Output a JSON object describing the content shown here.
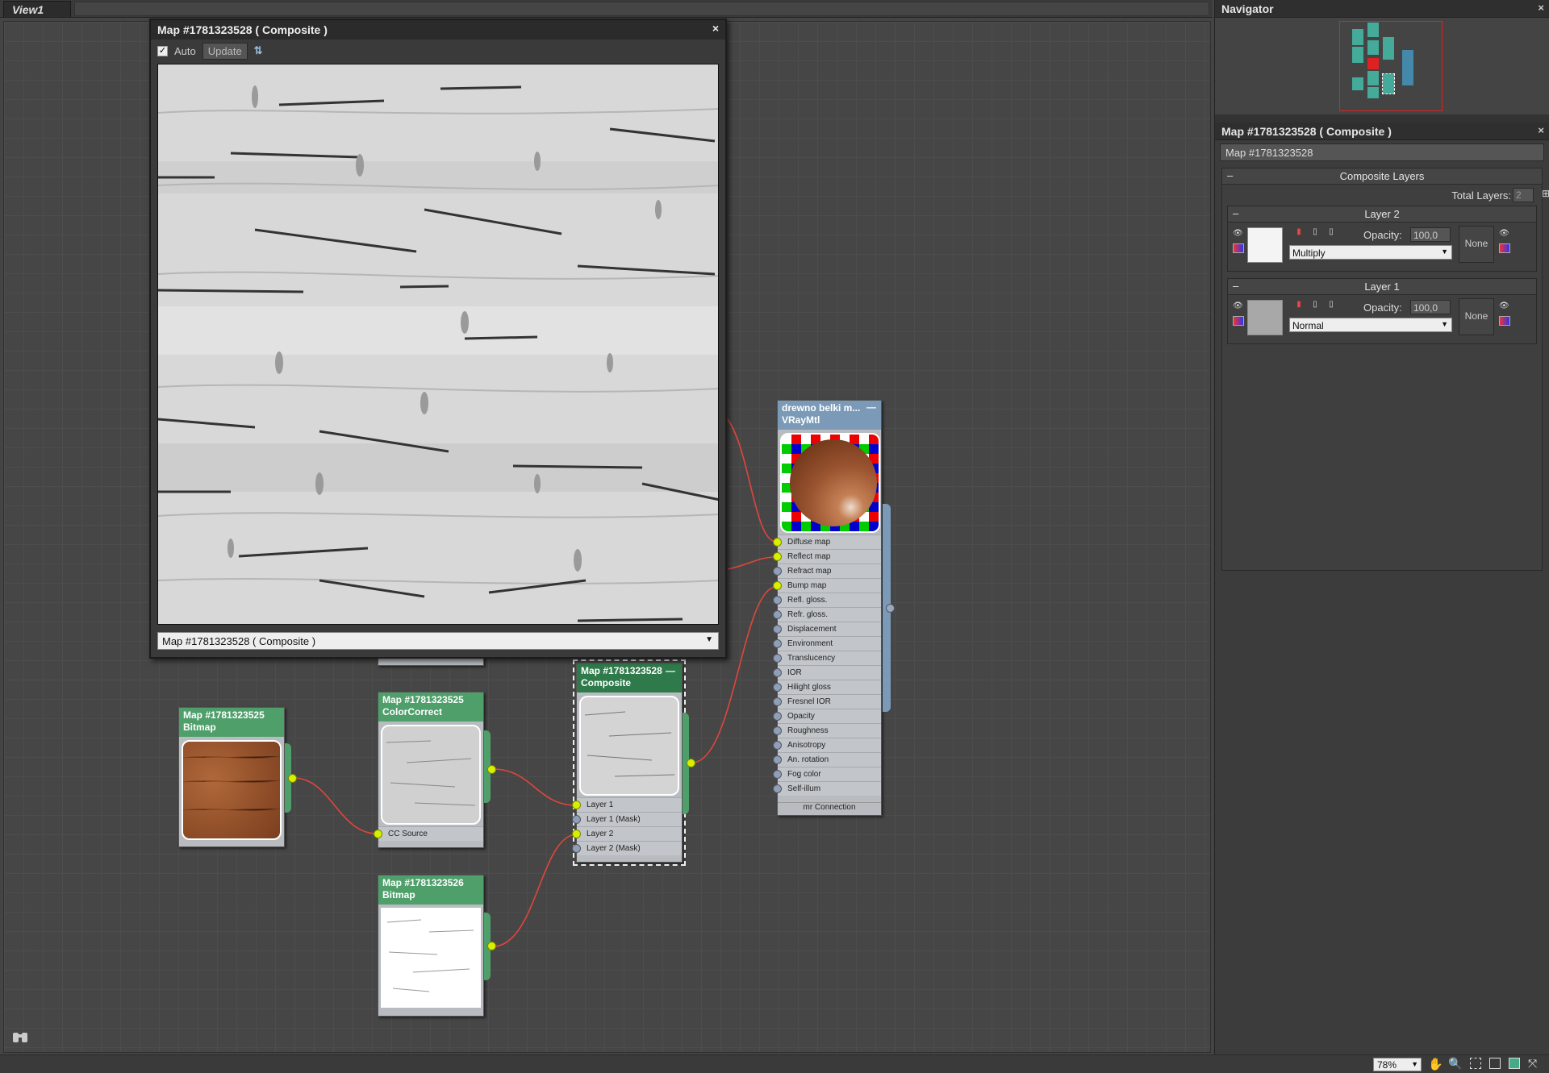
{
  "view": {
    "tab": "View1"
  },
  "preview": {
    "title": "Map #1781323528  ( Composite )",
    "auto_label": "Auto",
    "update_label": "Update",
    "selector_value": "Map #1781323528  ( Composite )"
  },
  "nodes": {
    "bitmap1": {
      "name": "Map #1781323525",
      "type": "Bitmap"
    },
    "colorcorrect": {
      "name": "Map #1781323525",
      "type": "ColorCorrect",
      "slot": "CC Source"
    },
    "bitmap2": {
      "name": "Map #1781323526",
      "type": "Bitmap"
    },
    "composite": {
      "name": "Map #1781323528",
      "type": "Composite",
      "slots": [
        "Layer 1",
        "Layer 1 (Mask)",
        "Layer 2",
        "Layer 2 (Mask)"
      ]
    },
    "vray": {
      "name": "drewno belki m...",
      "type": "VRayMtl",
      "slots": [
        "Diffuse map",
        "Reflect map",
        "Refract map",
        "Bump map",
        "Refl. gloss.",
        "Refr. gloss.",
        "Displacement",
        "Environment",
        "Translucency",
        "IOR",
        "Hilight gloss",
        "Fresnel IOR",
        "Opacity",
        "Roughness",
        "Anisotropy",
        "An. rotation",
        "Fog color",
        "Self-illum"
      ],
      "footer": "mr Connection"
    }
  },
  "navigator": {
    "title": "Navigator"
  },
  "params": {
    "title": "Map #1781323528  ( Composite )",
    "name_field": "Map #1781323528",
    "rollout": "Composite Layers",
    "total_layers_label": "Total Layers:",
    "total_layers_value": "2",
    "layers": [
      {
        "title": "Layer 2",
        "opacity_label": "Opacity:",
        "opacity": "100,0",
        "mode": "Multiply",
        "mask": "None"
      },
      {
        "title": "Layer 1",
        "opacity_label": "Opacity:",
        "opacity": "100,0",
        "mode": "Normal",
        "mask": "None"
      }
    ]
  },
  "statusbar": {
    "zoom": "78%"
  }
}
